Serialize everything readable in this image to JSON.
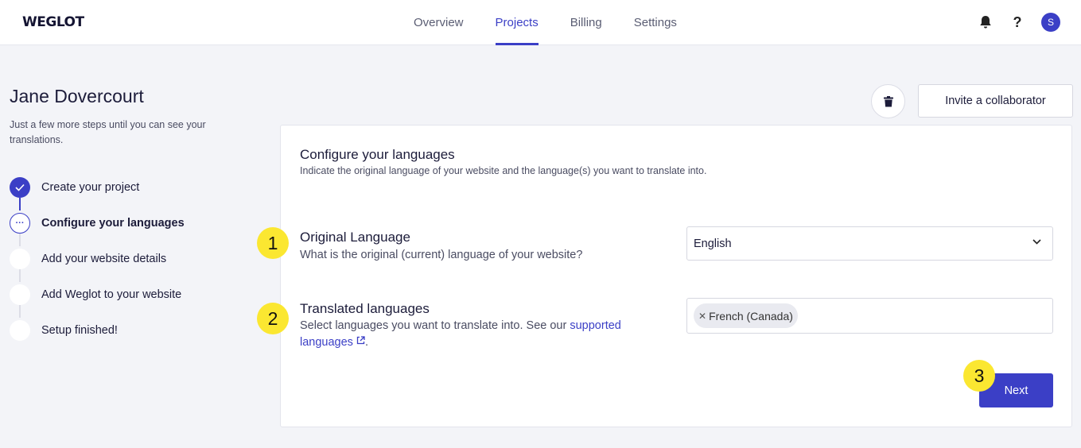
{
  "header": {
    "logo": "WEGLOT",
    "nav": [
      "Overview",
      "Projects",
      "Billing",
      "Settings"
    ],
    "active_nav": "Projects",
    "avatar_initial": "S"
  },
  "sidebar": {
    "user_name": "Jane Dovercourt",
    "subtitle": "Just a few more steps until you can see your translations.",
    "steps": [
      {
        "label": "Create your project",
        "state": "done"
      },
      {
        "label": "Configure your languages",
        "state": "current"
      },
      {
        "label": "Add your website details",
        "state": "todo"
      },
      {
        "label": "Add Weglot to your website",
        "state": "todo"
      },
      {
        "label": "Setup finished!",
        "state": "todo"
      }
    ]
  },
  "actions": {
    "invite_label": "Invite a collaborator"
  },
  "card": {
    "title": "Configure your languages",
    "subtitle": "Indicate the original language of your website and the language(s) you want to translate into.",
    "original": {
      "badge": "1",
      "title": "Original Language",
      "desc": "What is the original (current) language of your website?",
      "value": "English"
    },
    "translated": {
      "badge": "2",
      "title": "Translated languages",
      "desc_prefix": "Select languages you want to translate into. See our ",
      "link_text_1": "supported",
      "link_text_2": "languages",
      "desc_suffix": ".",
      "chips": [
        "French (Canada)"
      ]
    },
    "next_badge": "3",
    "next_label": "Next"
  },
  "colors": {
    "accent": "#3b3fc6",
    "badge": "#fbe731",
    "background": "#f3f4f8"
  }
}
